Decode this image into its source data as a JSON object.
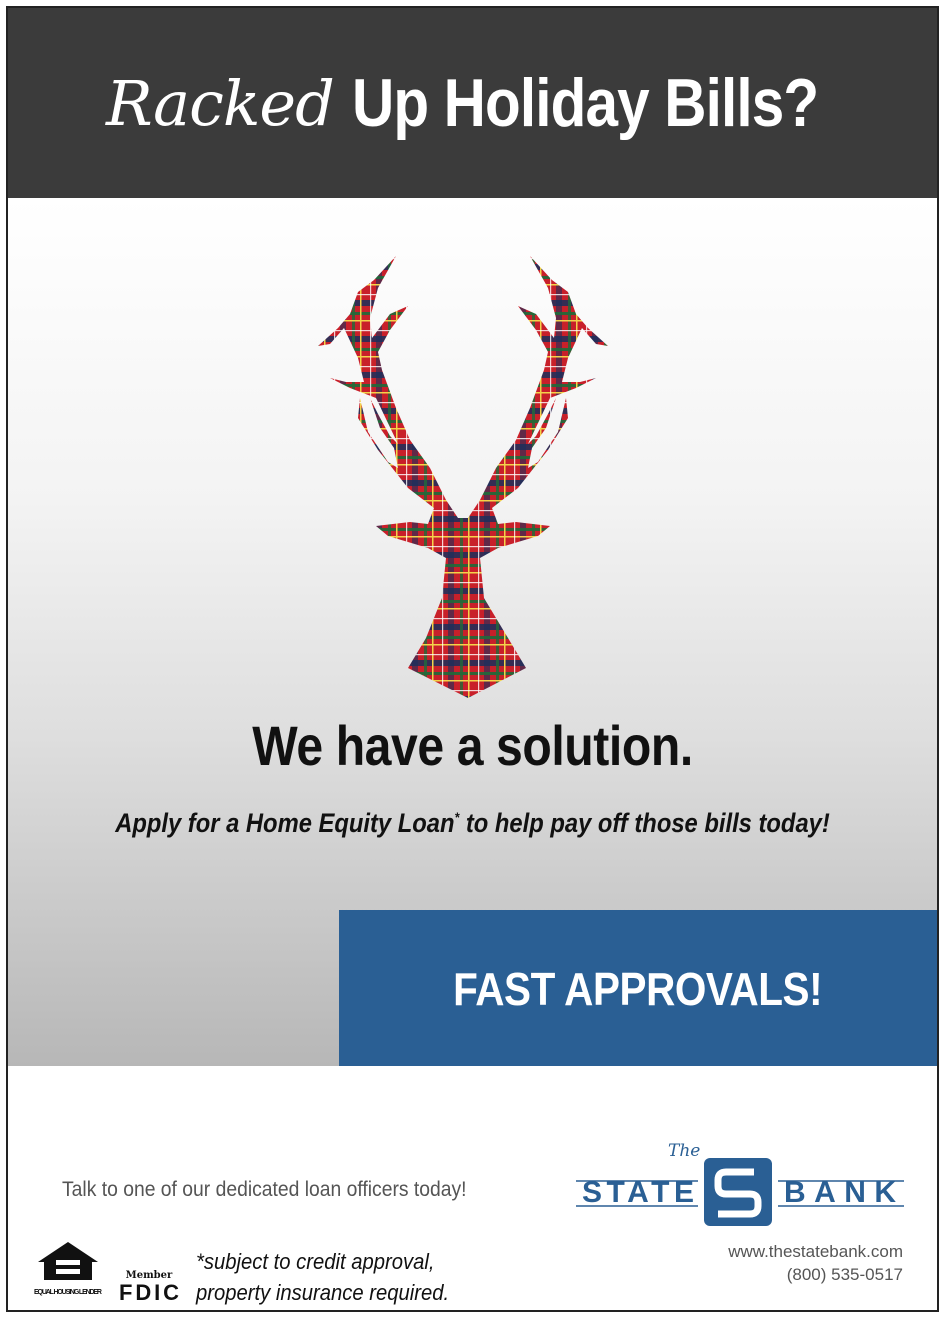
{
  "header": {
    "title_script": "Racked",
    "title_main": "Up Holiday Bills?"
  },
  "hero": {
    "illustration": "plaid-stag-head",
    "headline": "We have a solution.",
    "subline_before": "Apply for a Home Equity Loan",
    "subline_mark": "*",
    "subline_after": " to help pay off those bills today!"
  },
  "banner": {
    "label": "FAST APPROVALS!"
  },
  "footer": {
    "talk": "Talk to one of our dedicated loan officers today!",
    "bank": {
      "the": "The",
      "state": "STATE",
      "bank": "BANK"
    },
    "website": "www.thestatebank.com",
    "phone": "(800) 535-0517",
    "disclaimer_line1": "*subject to credit approval,",
    "disclaimer_line2": "property insurance required.",
    "ehl_text": "EQUAL HOUSING LENDER",
    "fdic_member": "Member",
    "fdic": "FDIC"
  },
  "colors": {
    "header_bg": "#3b3b3b",
    "banner_blue": "#2a5f94",
    "plaid_red": "#c8202a"
  }
}
